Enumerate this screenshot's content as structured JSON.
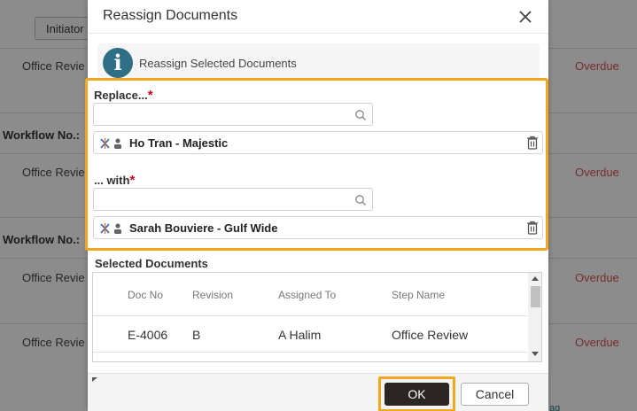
{
  "background": {
    "initiator_button": "Initiator",
    "row_texts": [
      "Office Revie",
      "Office Revie",
      "Office Revie",
      "Office Revie"
    ],
    "workflow_labels": [
      "Workflow No.:",
      "Workflow No.:"
    ],
    "overdue_texts": [
      "Overdue",
      "Overdue",
      "Overdue",
      "Overdue"
    ],
    "bottom_link": "ag"
  },
  "modal": {
    "title": "Reassign Documents",
    "info_icon": "info-icon",
    "info_text": "Reassign Selected Documents",
    "replace": {
      "label": "Replace...",
      "required_mark": "*",
      "search_value": "",
      "person_name": "Ho Tran - Majestic"
    },
    "with": {
      "label": "... with",
      "required_mark": "*",
      "search_value": "",
      "person_name": "Sarah Bouviere - Gulf Wide"
    },
    "selected_documents": {
      "label": "Selected Documents",
      "columns": [
        "Doc No",
        "Revision",
        "Assigned To",
        "Step Name"
      ],
      "rows": [
        {
          "doc_no": "E-4006",
          "revision": "B",
          "assigned_to": "A Halim",
          "step_name": "Office Review"
        }
      ]
    },
    "footer": {
      "ok_label": "OK",
      "cancel_label": "Cancel"
    },
    "colors": {
      "highlight": "#f2a81d",
      "info_icon_bg": "#2f6f86",
      "ok_bg": "#2b2523",
      "required": "#d0021b",
      "overdue": "#d9534f"
    }
  }
}
